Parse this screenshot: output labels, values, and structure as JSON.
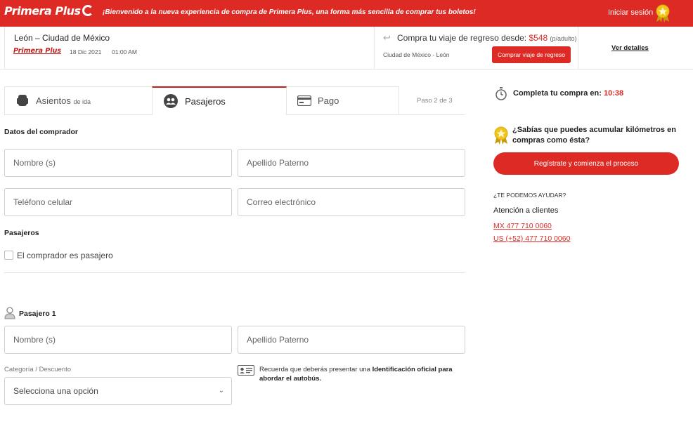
{
  "header": {
    "logo_text": "Primera Plus",
    "welcome": "¡Bienvenido a la nueva experiencia de compra de Primera Plus, una forma más sencilla de comprar tus boletos!",
    "login_label": "Iniciar sesión"
  },
  "trip": {
    "route": "León – Ciudad de México",
    "logo_text": "Primera Plus",
    "date": "18 Dic 2021",
    "time": "01:00 AM",
    "return_label": "Compra tu viaje de regreso desde:",
    "return_price": "$548",
    "return_unit": "(p/adulto)",
    "return_route": "Ciudad de México - León",
    "return_button": "Comprar viaje de regreso",
    "details_link": "Ver detalles"
  },
  "steps": {
    "tabs": [
      {
        "label": "Asientos",
        "sub": "de ida"
      },
      {
        "label": "Pasajeros"
      },
      {
        "label": "Pago"
      }
    ],
    "progress": "Paso 2 de 3"
  },
  "buyer": {
    "title": "Datos del comprador",
    "name_placeholder": "Nombre (s)",
    "lastname_placeholder": "Apellido Paterno",
    "phone_placeholder": "Teléfono celular",
    "email_placeholder": "Correo electrónico"
  },
  "passengers": {
    "title": "Pasajeros",
    "buyer_is_passenger": "El comprador es pasajero",
    "passenger_title": "Pasajero 1",
    "name_placeholder": "Nombre (s)",
    "lastname_placeholder": "Apellido Paterno",
    "category_label": "Categoría / Descuento",
    "category_value": "Selecciona una opción",
    "id_note_prefix": "Recuerda que deberás presentar una ",
    "id_note_bold": "Identificación oficial para abordar el autobús."
  },
  "sidebar": {
    "timer_label": "Completa tu compra en:",
    "timer_value": "10:38",
    "km_text": "¿Sabías que puedes acumular kilómetros en compras como ésta?",
    "register_button": "Regístrate y comienza el proceso",
    "help_title": "¿TE PODEMOS AYUDAR?",
    "help_sub": "Atención a clientes",
    "phone_mx": "MX 477 710 0060",
    "phone_us": "US (+52) 477 710 0060"
  },
  "colors": {
    "brand_red": "#dd2a24",
    "medal_gold": "#e8b820"
  }
}
